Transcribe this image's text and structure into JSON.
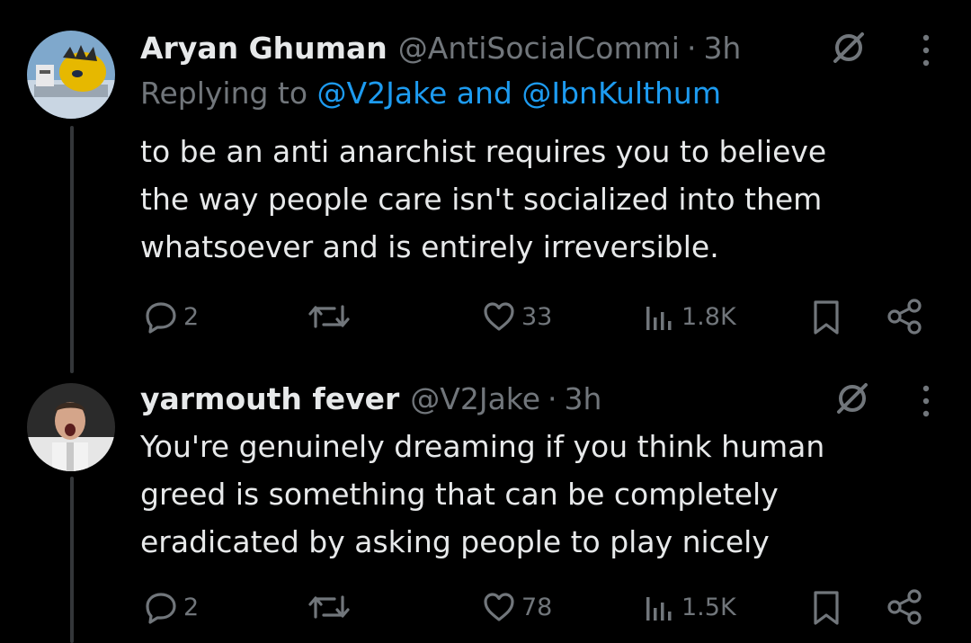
{
  "tweets": [
    {
      "name": "Aryan Ghuman",
      "handle": "@AntiSocialCommi",
      "dot": "·",
      "time": "3h",
      "reply_prefix": "Replying to ",
      "reply_users": "@V2Jake and @IbnKulthum",
      "text": "to be an anti anarchist requires you to believe\nthe way people care isn't socialized into them\nwhatsoever and is entirely irreversible.",
      "replies": "2",
      "likes": "33",
      "views": "1.8K",
      "icons": [
        "grok-icon",
        "more-icon",
        "reply-icon",
        "retweet-icon",
        "like-icon",
        "views-icon",
        "bookmark-icon",
        "share-icon"
      ]
    },
    {
      "name": "yarmouth fever",
      "handle": "@V2Jake",
      "dot": "·",
      "time": "3h",
      "text": "You're genuinely dreaming if you think human\ngreed is something that can be completely\neradicated by asking people to play nicely",
      "replies": "2",
      "likes": "78",
      "views": "1.5K",
      "icons": [
        "grok-icon",
        "more-icon",
        "reply-icon",
        "retweet-icon",
        "like-icon",
        "views-icon",
        "bookmark-icon",
        "share-icon"
      ]
    }
  ],
  "colors": {
    "background": "#000000",
    "text": "#e7e9ea",
    "secondary": "#71767b",
    "link": "#1d9bf0",
    "thread_line": "#333639"
  }
}
